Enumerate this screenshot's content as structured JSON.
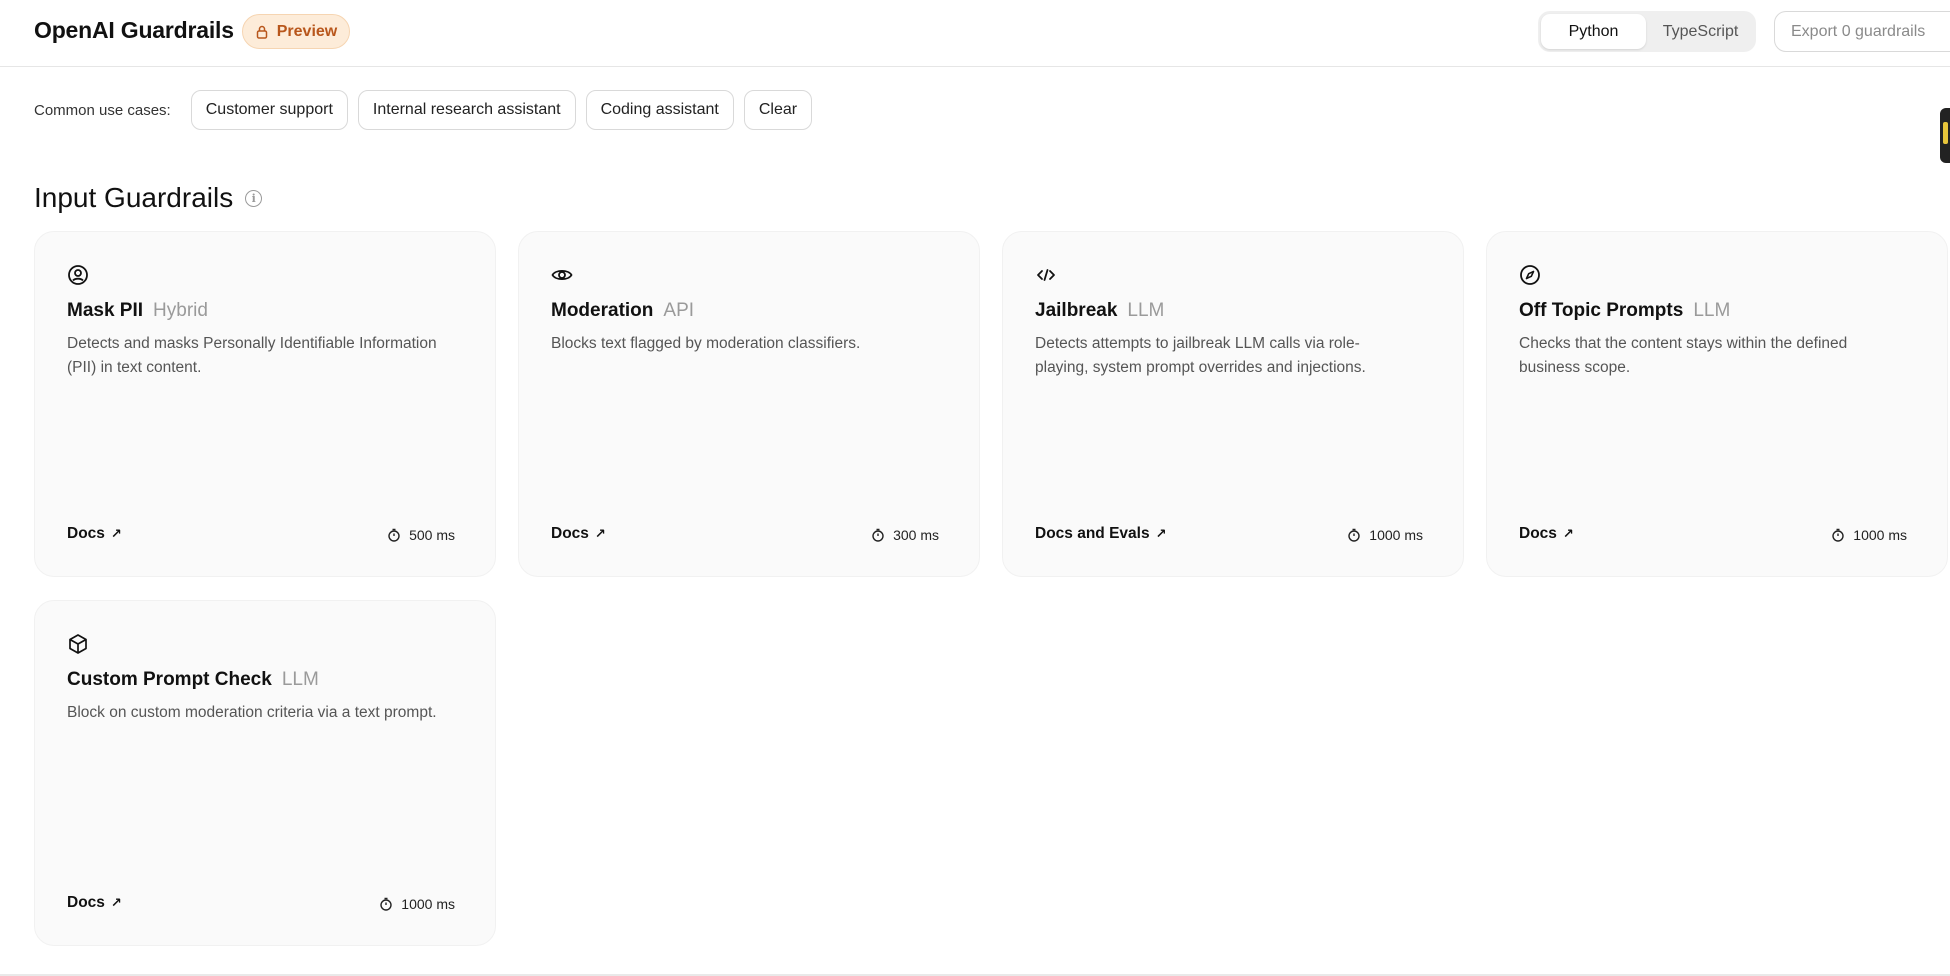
{
  "header": {
    "brand": "OpenAI Guardrails",
    "badge": "Preview",
    "languages": [
      "Python",
      "TypeScript"
    ],
    "selected_language": "Python",
    "export_label": "Export 0 guardrails"
  },
  "usecases": {
    "label": "Common use cases:",
    "chips": [
      "Customer support",
      "Internal research assistant",
      "Coding assistant",
      "Clear"
    ]
  },
  "section": {
    "title": "Input Guardrails"
  },
  "cards": [
    {
      "icon": "face-icon",
      "title": "Mask PII",
      "kind": "Hybrid",
      "description": "Detects and masks Personally Identifiable Information (PII) in text content.",
      "link": "Docs",
      "latency": "500 ms"
    },
    {
      "icon": "eye-icon",
      "title": "Moderation",
      "kind": "API",
      "description": "Blocks text flagged by moderation classifiers.",
      "link": "Docs",
      "latency": "300 ms"
    },
    {
      "icon": "code-icon",
      "title": "Jailbreak",
      "kind": "LLM",
      "description": "Detects attempts to jailbreak LLM calls via role-playing, system prompt overrides and injections.",
      "link": "Docs and Evals",
      "latency": "1000 ms"
    },
    {
      "icon": "compass-icon",
      "title": "Off Topic Prompts",
      "kind": "LLM",
      "description": "Checks that the content stays within the defined business scope.",
      "link": "Docs",
      "latency": "1000 ms"
    },
    {
      "icon": "cube-icon",
      "title": "Custom Prompt Check",
      "kind": "LLM",
      "description": "Block on custom moderation criteria via a text prompt.",
      "link": "Docs",
      "latency": "1000 ms"
    }
  ]
}
